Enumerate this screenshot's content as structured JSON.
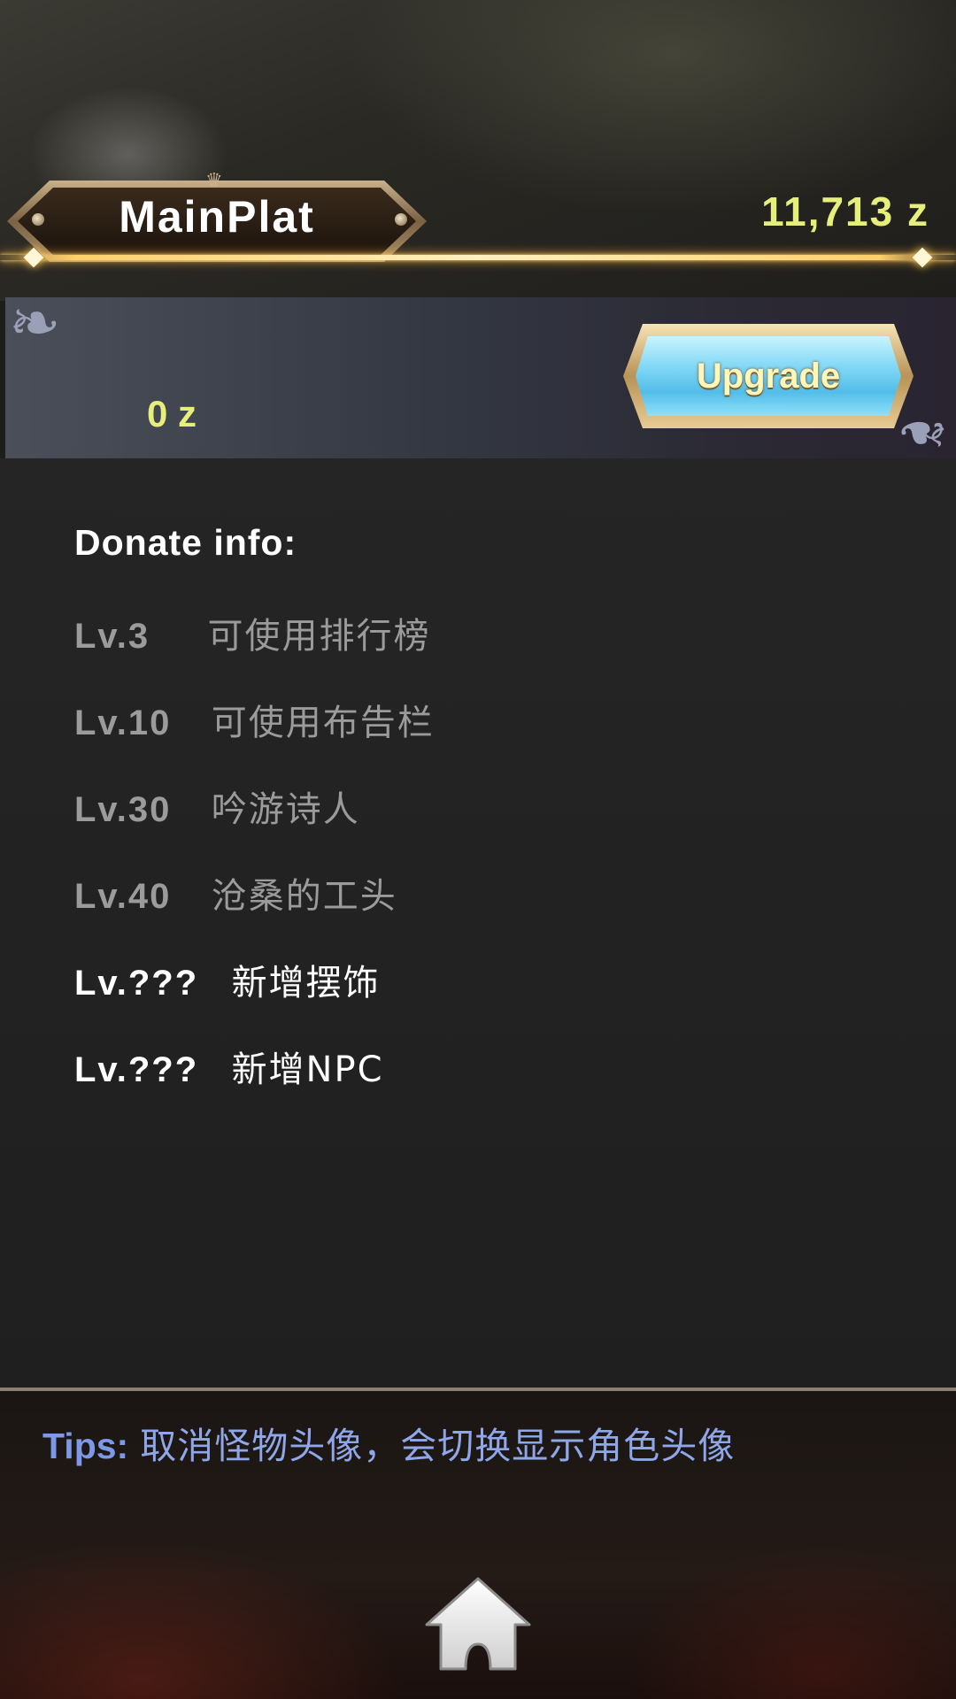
{
  "header": {
    "title": "MainPlat",
    "balance": "11,713 z"
  },
  "upgrade_panel": {
    "donated_amount": "0 z",
    "upgrade_label": "Upgrade"
  },
  "donate_info": {
    "heading": "Donate info:",
    "rows": [
      {
        "level": "Lv.3",
        "text": "可使用排行榜",
        "unlocked": true
      },
      {
        "level": "Lv.10",
        "text": "可使用布告栏",
        "unlocked": true
      },
      {
        "level": "Lv.30",
        "text": "吟游诗人",
        "unlocked": true
      },
      {
        "level": "Lv.40",
        "text": "沧桑的工头",
        "unlocked": true
      },
      {
        "level": "Lv.???",
        "text": "新增摆饰",
        "unlocked": false
      },
      {
        "level": "Lv.???",
        "text": "新增NPC",
        "unlocked": false
      }
    ]
  },
  "tips": {
    "label": "Tips:",
    "text": "取消怪物头像，会切换显示角色头像"
  },
  "icons": {
    "home": "home-icon",
    "corner": "corner-ornament-icon"
  },
  "colors": {
    "currency_yellow": "#e6ef7c",
    "unlocked_gray": "#9b9b9b",
    "locked_white": "#ffffff",
    "tips_blue": "#8fa6e8",
    "gold_line": "#ffcf6b"
  }
}
